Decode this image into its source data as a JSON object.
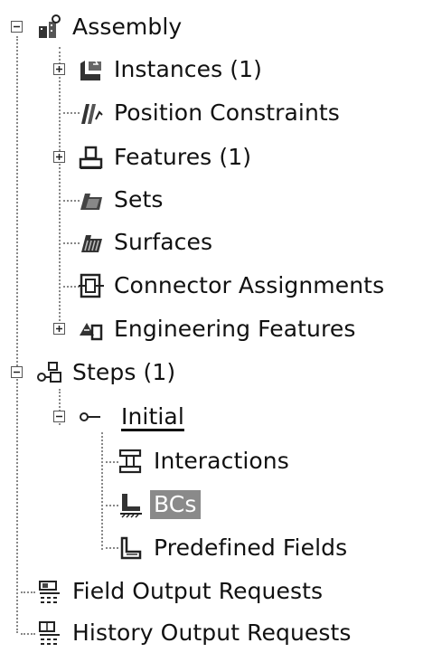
{
  "tree": {
    "assembly": {
      "label": "Assembly",
      "icon": "assembly-icon"
    },
    "instances": {
      "label": "Instances (1)",
      "icon": "instances-icon"
    },
    "position_constraints": {
      "label": "Position Constraints",
      "icon": "position-constraints-icon"
    },
    "features": {
      "label": "Features (1)",
      "icon": "features-icon"
    },
    "sets": {
      "label": "Sets",
      "icon": "sets-icon"
    },
    "surfaces": {
      "label": "Surfaces",
      "icon": "surfaces-icon"
    },
    "connector_assignments": {
      "label": "Connector Assignments",
      "icon": "connector-assignments-icon"
    },
    "engineering_features": {
      "label": "Engineering Features",
      "icon": "engineering-features-icon"
    },
    "steps": {
      "label": "Steps (1)",
      "icon": "steps-icon"
    },
    "initial": {
      "label": "Initial",
      "icon": "step-initial-icon"
    },
    "interactions": {
      "label": "Interactions",
      "icon": "interactions-icon"
    },
    "bcs": {
      "label": "BCs",
      "icon": "bcs-icon",
      "selected": true
    },
    "predefined_fields": {
      "label": "Predefined Fields",
      "icon": "predefined-fields-icon"
    },
    "field_output_requests": {
      "label": "Field Output Requests",
      "icon": "field-output-icon"
    },
    "history_output_requests": {
      "label": "History Output Requests",
      "icon": "history-output-icon"
    }
  },
  "colors": {
    "selection_bg": "#8a8a8a",
    "selection_text": "#ffffff",
    "tree_line": "#888888"
  }
}
